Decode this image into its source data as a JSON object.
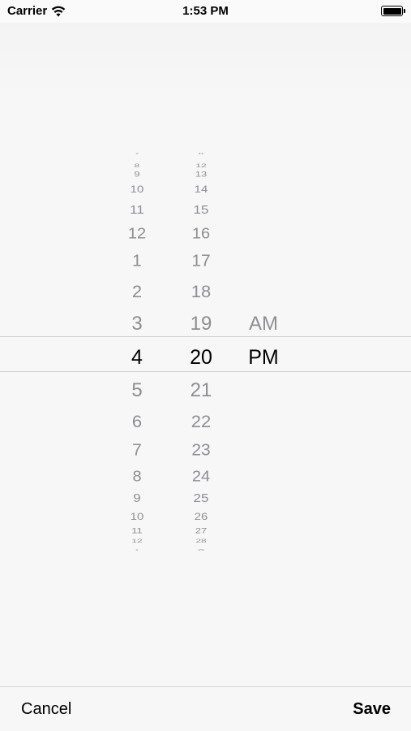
{
  "status_bar": {
    "carrier": "Carrier",
    "time": "1:53 PM",
    "wifi_icon": "wifi-icon",
    "battery_icon": "battery-icon"
  },
  "picker": {
    "hours": [
      "7",
      "8",
      "9",
      "10",
      "11",
      "12",
      "1",
      "2",
      "3",
      "4",
      "5",
      "6",
      "7",
      "8",
      "9",
      "10",
      "11",
      "12",
      "1"
    ],
    "minutes": [
      "11",
      "12",
      "13",
      "14",
      "15",
      "16",
      "17",
      "18",
      "19",
      "20",
      "21",
      "22",
      "23",
      "24",
      "25",
      "26",
      "27",
      "28",
      "29"
    ],
    "periods": [
      "AM",
      "PM"
    ],
    "selected_hour": "4",
    "selected_minute": "20",
    "selected_period": "PM"
  },
  "toolbar": {
    "cancel_label": "Cancel",
    "save_label": "Save"
  }
}
